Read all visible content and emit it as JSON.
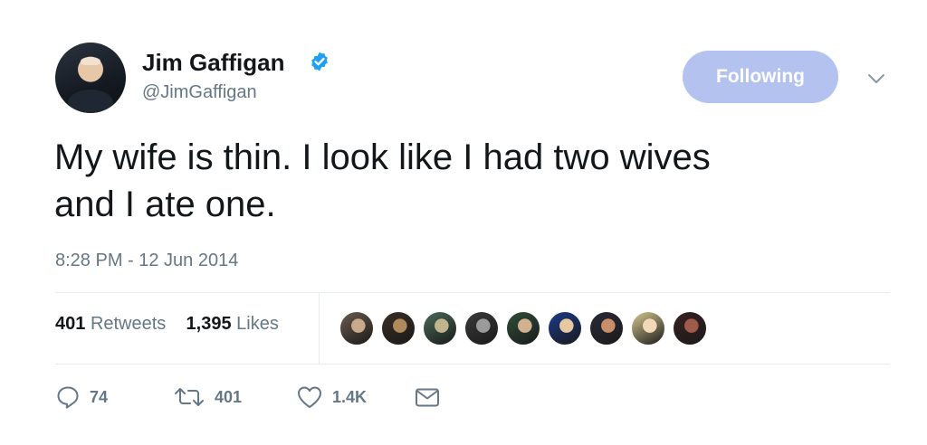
{
  "tweet": {
    "author": {
      "name": "Jim Gaffigan",
      "handle": "@JimGaffigan",
      "verified_icon": "verified-badge-icon",
      "avatar_icon": "avatar"
    },
    "follow_button_label": "Following",
    "menu_icon": "chevron-down-icon",
    "text_line1": "My wife is thin. I look like I had two wives",
    "text_line2": "and I ate one.",
    "timestamp": "8:28 PM - 12 Jun 2014",
    "stats": {
      "retweets_count": "401",
      "retweets_label": "Retweets",
      "likes_count": "1,395",
      "likes_label": "Likes"
    },
    "likers": [
      {
        "colors": [
          "#6b5b4e",
          "#c9a98a"
        ]
      },
      {
        "colors": [
          "#3a2e24",
          "#b08a5a"
        ]
      },
      {
        "colors": [
          "#4a6b5a",
          "#c2b58e"
        ]
      },
      {
        "colors": [
          "#3a3a3a",
          "#9a9a9a"
        ]
      },
      {
        "colors": [
          "#2f4f3a",
          "#d3b08e"
        ]
      },
      {
        "colors": [
          "#1a3a8c",
          "#e8c8a0"
        ]
      },
      {
        "colors": [
          "#2a2a3a",
          "#c88e6a"
        ]
      },
      {
        "colors": [
          "#d8c890",
          "#f0d8b8"
        ]
      },
      {
        "colors": [
          "#3a2020",
          "#a05a4a"
        ]
      }
    ],
    "actions": {
      "reply_count": "74",
      "retweet_count": "401",
      "like_count": "1.4K"
    },
    "colors": {
      "text": "#14171a",
      "secondary": "#657786",
      "accent": "#1da1f2",
      "following_button": "#b3c2ee"
    }
  }
}
